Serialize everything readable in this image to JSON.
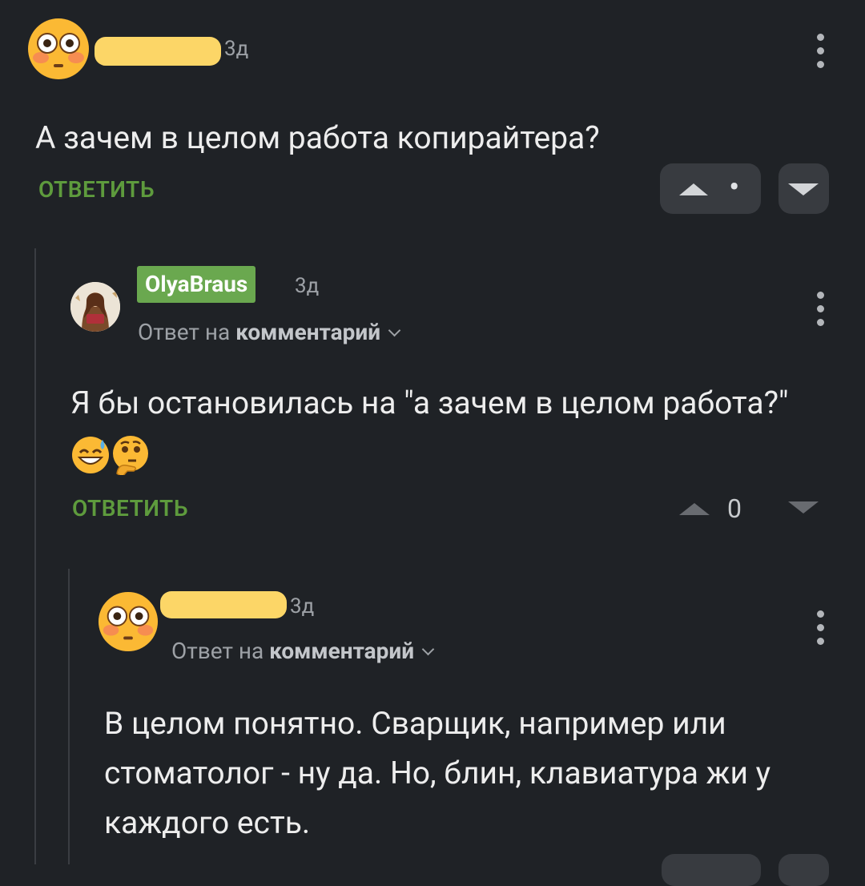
{
  "comment1": {
    "time": "3д",
    "text": "А зачем в целом работа копирайтера?",
    "reply_label": "ОТВЕТИТЬ",
    "rating": "•",
    "avatar_icon": "flushed-face-icon"
  },
  "comment2": {
    "username": "OlyaBraus",
    "time": "3д",
    "reply_to_prefix": "Ответ на",
    "reply_to_target": "комментарий",
    "text": "Я бы остановилась на \"а зачем в целом работа?\"",
    "emojis": [
      "grinning-sweat-icon",
      "thinking-face-icon"
    ],
    "reply_label": "ОТВЕТИТЬ",
    "rating": "0"
  },
  "comment3": {
    "time": "3д",
    "reply_to_prefix": "Ответ на",
    "reply_to_target": "комментарий",
    "text": "В целом понятно. Сварщик, например или стоматолог - ну да. Но, блин, клавиатура жи у каждого есть.",
    "avatar_icon": "flushed-face-icon"
  },
  "colors": {
    "background": "#1f2226",
    "reply_green": "#5e9b3d",
    "badge_green": "#6aa84f",
    "redaction": "#fcd667"
  }
}
